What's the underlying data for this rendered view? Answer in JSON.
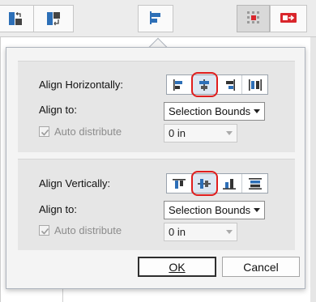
{
  "toolbar": {
    "icons": [
      "paste-left-icon",
      "paste-right-icon",
      "align-left-icon",
      "grid-snap-icon",
      "present-icon"
    ]
  },
  "dialog": {
    "horizontal": {
      "label": "Align Horizontally:",
      "icons": [
        "align-left-edges-icon",
        "align-centers-horizontal-icon",
        "align-right-edges-icon",
        "distribute-horizontal-icon"
      ],
      "align_to_label": "Align to:",
      "align_to_value": "Selection Bounds",
      "auto_distribute_label": "Auto distribute",
      "auto_distribute_checked": true,
      "spacing_value": "0 in"
    },
    "vertical": {
      "label": "Align Vertically:",
      "icons": [
        "align-top-edges-icon",
        "align-centers-vertical-icon",
        "align-bottom-edges-icon",
        "distribute-vertical-icon"
      ],
      "align_to_label": "Align to:",
      "align_to_value": "Selection Bounds",
      "auto_distribute_label": "Auto distribute",
      "auto_distribute_checked": true,
      "spacing_value": "0 in"
    },
    "ok_label": "OK",
    "cancel_label": "Cancel"
  },
  "colors": {
    "accent": "#2d6fb7",
    "highlight": "#e01e1e"
  }
}
